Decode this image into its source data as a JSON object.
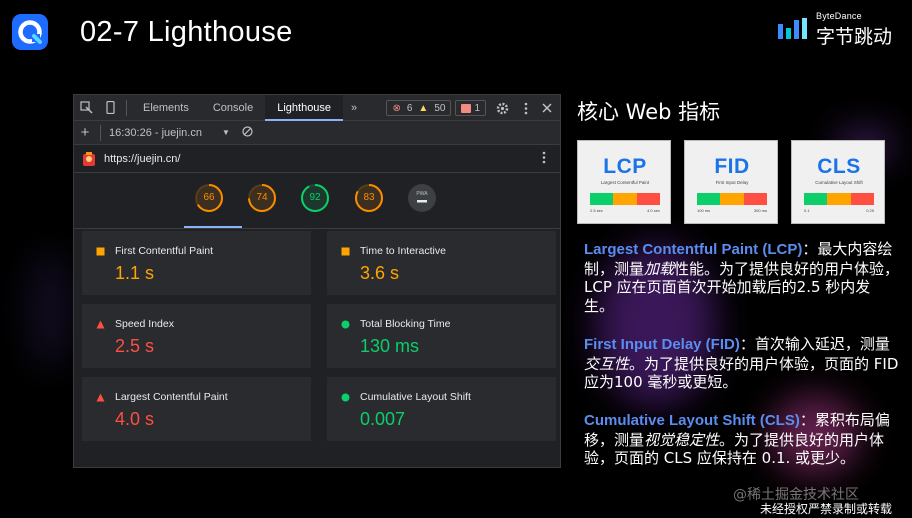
{
  "slide": {
    "title": "02-7 Lighthouse"
  },
  "brand": {
    "small": "ByteDance",
    "big": "字节跳动"
  },
  "devtools": {
    "tabs": [
      "Elements",
      "Console",
      "Lighthouse"
    ],
    "active_tab": "Lighthouse",
    "more": "»",
    "errors": "6",
    "warnings": "50",
    "issues": "1",
    "toolbar": {
      "add": "+",
      "report_time": "16:30:26 - juejin.cn",
      "dropdown": "▼"
    },
    "url": "https://juejin.cn/",
    "scores": [
      {
        "value": "66",
        "color": "#fb8c00",
        "fraction": 0.66
      },
      {
        "value": "74",
        "color": "#fb8c00",
        "fraction": 0.74
      },
      {
        "value": "92",
        "color": "#0cce6b",
        "fraction": 0.92
      },
      {
        "value": "83",
        "color": "#fb8c00",
        "fraction": 0.83
      },
      {
        "value": "PWA",
        "color": "#9aa0a6",
        "fraction": 0
      }
    ],
    "metrics": [
      {
        "name": "First Contentful Paint",
        "value": "1.1 s",
        "status": "average",
        "color": "#ffa400"
      },
      {
        "name": "Time to Interactive",
        "value": "3.6 s",
        "status": "average",
        "color": "#ffa400"
      },
      {
        "name": "Speed Index",
        "value": "2.5 s",
        "status": "fail",
        "color": "#ff4e42"
      },
      {
        "name": "Total Blocking Time",
        "value": "130 ms",
        "status": "pass",
        "color": "#0cce6b"
      },
      {
        "name": "Largest Contentful Paint",
        "value": "4.0 s",
        "status": "fail",
        "color": "#ff4e42"
      },
      {
        "name": "Cumulative Layout Shift",
        "value": "0.007",
        "status": "pass",
        "color": "#0cce6b"
      }
    ]
  },
  "vitals": {
    "title": "核心 Web 指标",
    "cards": [
      {
        "abbr": "LCP",
        "full": "Largest Contentful Paint",
        "bands": [
          "2.5 sec",
          "4.0 sec"
        ]
      },
      {
        "abbr": "FID",
        "full": "First Input Delay",
        "bands": [
          "100 ms",
          "300 ms"
        ]
      },
      {
        "abbr": "CLS",
        "full": "Cumulative Layout Shift",
        "bands": [
          "0.1",
          "0.25"
        ]
      }
    ],
    "band_colors": [
      "#0cce6b",
      "#ffa400",
      "#ff4e42"
    ],
    "descriptions": [
      {
        "term": "Largest Contentful Paint (LCP)",
        "p1": "：最大内容绘制，测量",
        "em": "加载",
        "p2": "性能。为了提供良好的用户体验，LCP 应在页面首次开始加载后的2.5 秒内发生。"
      },
      {
        "term": "First Input Delay (FID)",
        "p1": "：首次输入延迟，测量",
        "em": "交互性",
        "p2": "。为了提供良好的用户体验，页面的 FID 应为100 毫秒或更短。"
      },
      {
        "term": "Cumulative Layout Shift (CLS)",
        "p1": "：累积布局偏移，测量",
        "em": "视觉稳定性",
        "p2": "。为了提供良好的用户体验，页面的 CLS 应保持在 0.1. 或更少。"
      }
    ]
  },
  "watermark": "@稀土掘金技术社区",
  "footer_note": "未经授权严禁录制或转载"
}
